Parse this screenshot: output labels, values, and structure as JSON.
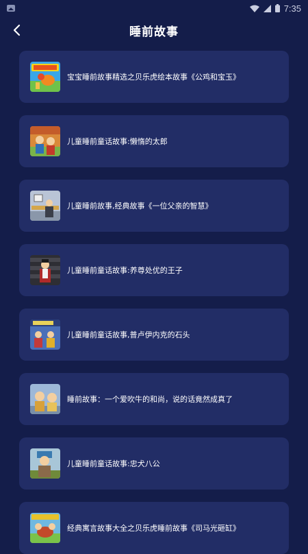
{
  "status_bar": {
    "time": "7:35"
  },
  "header": {
    "title": "睡前故事"
  },
  "stories": [
    {
      "title": "宝宝睡前故事精选之贝乐虎绘本故事《公鸡和宝玉》"
    },
    {
      "title": "儿童睡前童话故事:懒惰的太郎"
    },
    {
      "title": "儿童睡前故事,经典故事《一位父亲的智慧》"
    },
    {
      "title": "儿童睡前童话故事:养尊处优的王子"
    },
    {
      "title": "儿童睡前童话故事,普卢伊内克的石头"
    },
    {
      "title": "睡前故事：一个爱吹牛的和尚，说的话竟然成真了"
    },
    {
      "title": "儿童睡前童话故事:忠犬八公"
    },
    {
      "title": "经典寓言故事大全之贝乐虎睡前故事《司马光砸缸》"
    }
  ],
  "colors": {
    "background": "#141d4a",
    "card": "#222d66",
    "text": "#ffffff"
  }
}
